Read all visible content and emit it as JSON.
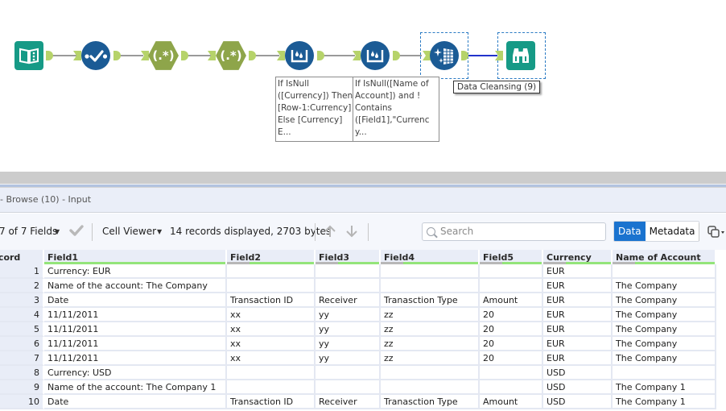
{
  "canvas": {
    "tools": [
      {
        "name": "input-data",
        "icon": "book-icon"
      },
      {
        "name": "select",
        "icon": "checkmark-icon"
      },
      {
        "name": "regex-1",
        "icon": "regex-icon",
        "label": "(.*)"
      },
      {
        "name": "regex-2",
        "icon": "regex-icon",
        "label": "(.*)"
      },
      {
        "name": "multi-row-formula-1",
        "icon": "multi-row-formula-icon"
      },
      {
        "name": "multi-row-formula-2",
        "icon": "multi-row-formula-icon"
      },
      {
        "name": "data-cleansing",
        "icon": "data-cleansing-icon"
      },
      {
        "name": "browse",
        "icon": "binoculars-icon"
      }
    ],
    "annotations": [
      "If IsNull\n([Currency]) Then\n[Row-1:Currency]\nElse [Currency]\nE...",
      "If IsNull([Name of\nAccount]) and !\nContains\n([Field1],\"Currenc\ny..."
    ],
    "tooltip": "Data Cleansing (9)",
    "colors": {
      "anchor": "#b6d36a",
      "selected_connection": "#2233cc",
      "tool_blue": "#1b5b95",
      "tool_teal": "#169a86",
      "tool_green": "#8ea54a"
    }
  },
  "results": {
    "pane_title": "- Browse (10) - Input",
    "toolbar": {
      "fields_selector": "7 of 7 Fields",
      "cell_viewer": "Cell Viewer",
      "record_info": "14 records displayed, 2703 bytes",
      "search_placeholder": "Search",
      "data_tab": "Data",
      "metadata_tab": "Metadata"
    },
    "columns": [
      "Record",
      "Field1",
      "Field2",
      "Field3",
      "Field4",
      "Field5",
      "Currency",
      "Name of Account"
    ],
    "rows": [
      [
        "1",
        "Currency: EUR",
        "",
        "",
        "",
        "",
        "EUR",
        ""
      ],
      [
        "2",
        "Name of the account: The Company",
        "",
        "",
        "",
        "",
        "EUR",
        "The Company"
      ],
      [
        "3",
        "Date",
        "Transaction ID",
        "Receiver",
        "Tranasction Type",
        "Amount",
        "EUR",
        "The Company"
      ],
      [
        "4",
        "11/11/2011",
        "xx",
        "yy",
        "zz",
        "20",
        "EUR",
        "The Company"
      ],
      [
        "5",
        "11/11/2011",
        "xx",
        "yy",
        "zz",
        "20",
        "EUR",
        "The Company"
      ],
      [
        "6",
        "11/11/2011",
        "xx",
        "yy",
        "zz",
        "20",
        "EUR",
        "The Company"
      ],
      [
        "7",
        "11/11/2011",
        "xx",
        "yy",
        "zz",
        "20",
        "EUR",
        "The Company"
      ],
      [
        "8",
        "Currency: USD",
        "",
        "",
        "",
        "",
        "USD",
        ""
      ],
      [
        "9",
        "Name of the account: The Company 1",
        "",
        "",
        "",
        "",
        "USD",
        "The Company 1"
      ],
      [
        "10",
        "Date",
        "Transaction ID",
        "Receiver",
        "Tranasction Type",
        "Amount",
        "USD",
        "The Company 1"
      ]
    ],
    "colors": {
      "active_tab": "#1a73cf",
      "header_bar": "#94e47a"
    }
  }
}
